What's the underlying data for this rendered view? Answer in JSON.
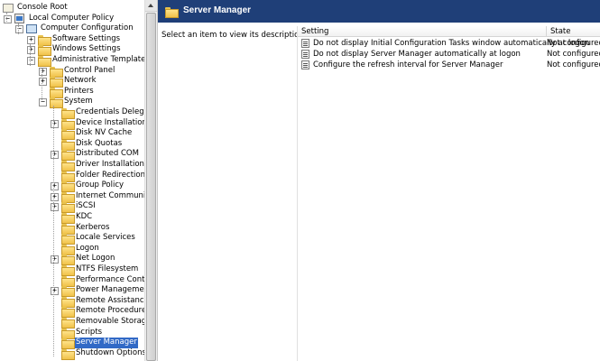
{
  "tree": {
    "items": [
      {
        "label": "Console Root",
        "level": 0,
        "icon": "console-icon",
        "expander": "none"
      },
      {
        "label": "Local Computer Policy",
        "level": 1,
        "icon": "policy-icon",
        "expander": "-"
      },
      {
        "label": "Computer Configuration",
        "level": 2,
        "icon": "computer-icon",
        "expander": "-"
      },
      {
        "label": "Software Settings",
        "level": 3,
        "icon": "folder-icon",
        "expander": "+"
      },
      {
        "label": "Windows Settings",
        "level": 3,
        "icon": "folder-icon",
        "expander": "+"
      },
      {
        "label": "Administrative Templates",
        "level": 3,
        "icon": "folder-icon",
        "expander": "-"
      },
      {
        "label": "Control Panel",
        "level": 4,
        "icon": "folder-icon",
        "expander": "+"
      },
      {
        "label": "Network",
        "level": 4,
        "icon": "folder-icon",
        "expander": "+"
      },
      {
        "label": "Printers",
        "level": 4,
        "icon": "folder-icon",
        "expander": "none"
      },
      {
        "label": "System",
        "level": 4,
        "icon": "folder-icon",
        "expander": "-"
      },
      {
        "label": "Credentials Delegatio",
        "level": 5,
        "icon": "folder-icon",
        "expander": "none"
      },
      {
        "label": "Device Installation",
        "level": 5,
        "icon": "folder-icon",
        "expander": "+"
      },
      {
        "label": "Disk NV Cache",
        "level": 5,
        "icon": "folder-icon",
        "expander": "none"
      },
      {
        "label": "Disk Quotas",
        "level": 5,
        "icon": "folder-icon",
        "expander": "none"
      },
      {
        "label": "Distributed COM",
        "level": 5,
        "icon": "folder-icon",
        "expander": "+"
      },
      {
        "label": "Driver Installation",
        "level": 5,
        "icon": "folder-icon",
        "expander": "none"
      },
      {
        "label": "Folder Redirection",
        "level": 5,
        "icon": "folder-icon",
        "expander": "none"
      },
      {
        "label": "Group Policy",
        "level": 5,
        "icon": "folder-icon",
        "expander": "+"
      },
      {
        "label": "Internet Communicati",
        "level": 5,
        "icon": "folder-icon",
        "expander": "+"
      },
      {
        "label": "iSCSI",
        "level": 5,
        "icon": "folder-icon",
        "expander": "+"
      },
      {
        "label": "KDC",
        "level": 5,
        "icon": "folder-icon",
        "expander": "none"
      },
      {
        "label": "Kerberos",
        "level": 5,
        "icon": "folder-icon",
        "expander": "none"
      },
      {
        "label": "Locale Services",
        "level": 5,
        "icon": "folder-icon",
        "expander": "none"
      },
      {
        "label": "Logon",
        "level": 5,
        "icon": "folder-icon",
        "expander": "none"
      },
      {
        "label": "Net Logon",
        "level": 5,
        "icon": "folder-icon",
        "expander": "+"
      },
      {
        "label": "NTFS Filesystem",
        "level": 5,
        "icon": "folder-icon",
        "expander": "none"
      },
      {
        "label": "Performance Control",
        "level": 5,
        "icon": "folder-icon",
        "expander": "none"
      },
      {
        "label": "Power Management",
        "level": 5,
        "icon": "folder-icon",
        "expander": "+"
      },
      {
        "label": "Remote Assistance",
        "level": 5,
        "icon": "folder-icon",
        "expander": "none"
      },
      {
        "label": "Remote Procedure C",
        "level": 5,
        "icon": "folder-icon",
        "expander": "none"
      },
      {
        "label": "Removable Storage A",
        "level": 5,
        "icon": "folder-icon",
        "expander": "none"
      },
      {
        "label": "Scripts",
        "level": 5,
        "icon": "folder-icon",
        "expander": "none"
      },
      {
        "label": "Server Manager",
        "level": 5,
        "icon": "folder-icon",
        "expander": "none",
        "selected": true
      },
      {
        "label": "Shutdown Options",
        "level": 5,
        "icon": "folder-icon",
        "expander": "none"
      }
    ]
  },
  "detail": {
    "header_title": "Server Manager",
    "description_prompt": "Select an item to view its description.",
    "columns": {
      "setting": "Setting",
      "state": "State"
    },
    "rows": [
      {
        "setting": "Do not display Initial Configuration Tasks window automatically at logon",
        "state": "Not configured"
      },
      {
        "setting": "Do not display Server Manager automatically at logon",
        "state": "Not configured"
      },
      {
        "setting": "Configure the refresh interval for Server Manager",
        "state": "Not configured"
      }
    ]
  },
  "colors": {
    "header_bg": "#1f3f78",
    "selection_bg": "#3169c6"
  }
}
